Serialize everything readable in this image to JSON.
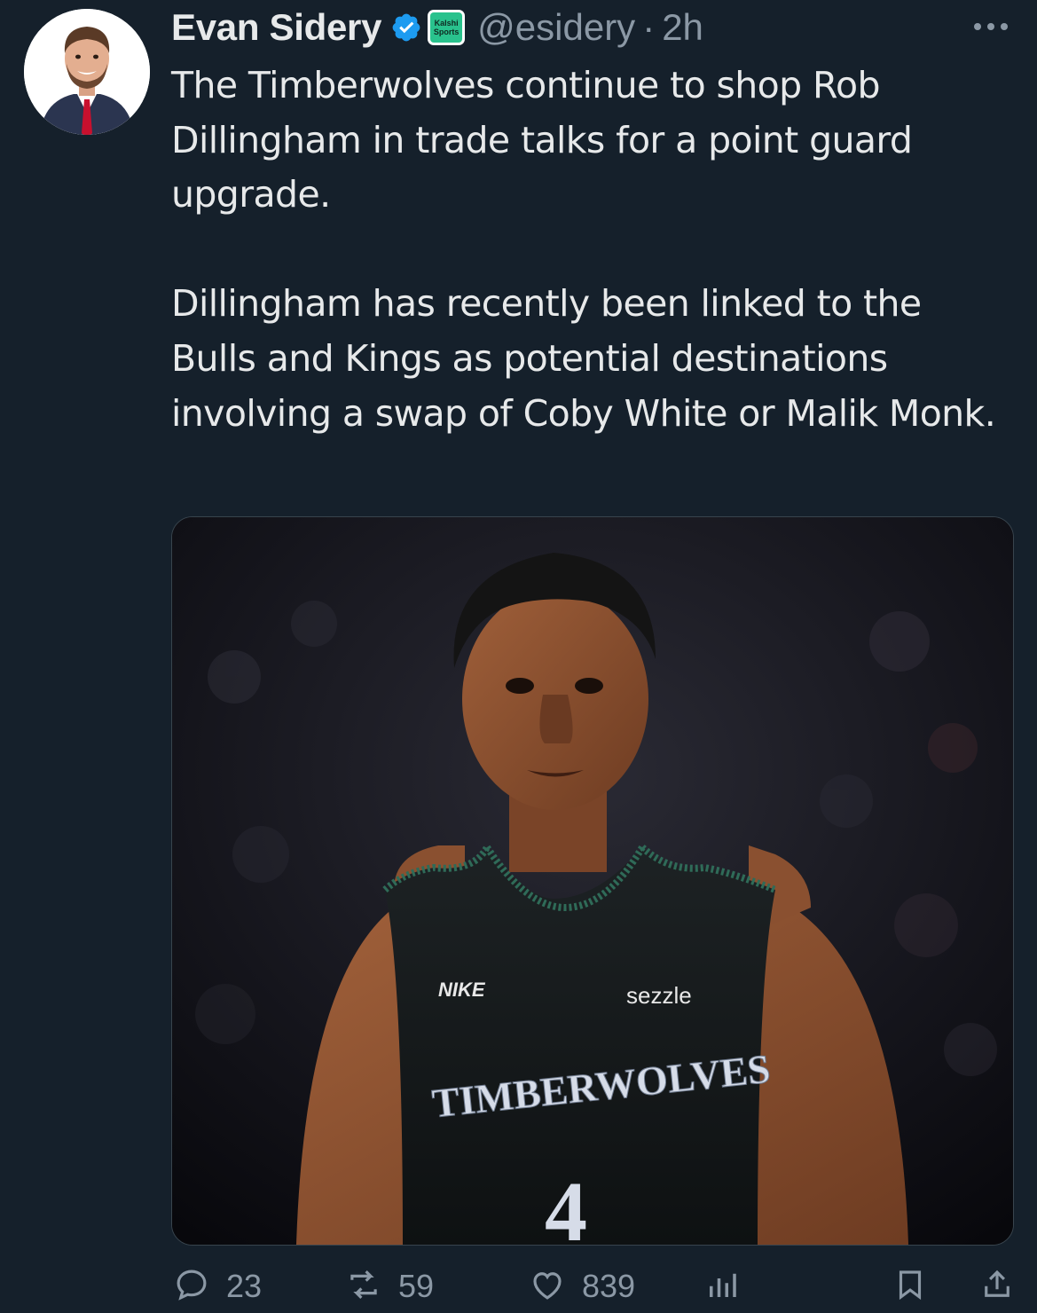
{
  "author": {
    "name": "Evan Sidery",
    "handle": "@esidery",
    "separator": "·",
    "time": "2h",
    "affiliation_badge": [
      "Kalshi",
      "Sports"
    ],
    "verified_color": "#1d9bf0",
    "affiliation_color": "#29c28d"
  },
  "tweet": {
    "paragraphs": [
      "The Timberwolves continue to shop Rob Dillingham in trade talks for a point guard upgrade.",
      "Dillingham has recently been linked to the Bulls and Kings as potential destinations involving a swap of Coby White or Malik Monk."
    ]
  },
  "media": {
    "jersey_wordmark": "TIMBERWOLVES",
    "jersey_sponsor": "sezzle",
    "jersey_brand": "NIKE",
    "jersey_number": "4"
  },
  "actions": {
    "replies": "23",
    "reposts": "59",
    "likes": "839"
  },
  "icons": [
    "verified-icon",
    "more-icon",
    "reply-icon",
    "repost-icon",
    "like-icon",
    "views-icon",
    "bookmark-icon",
    "share-icon"
  ],
  "colors": {
    "background": "#15202b",
    "text": "#e7e9ea",
    "muted": "#8b98a5"
  }
}
